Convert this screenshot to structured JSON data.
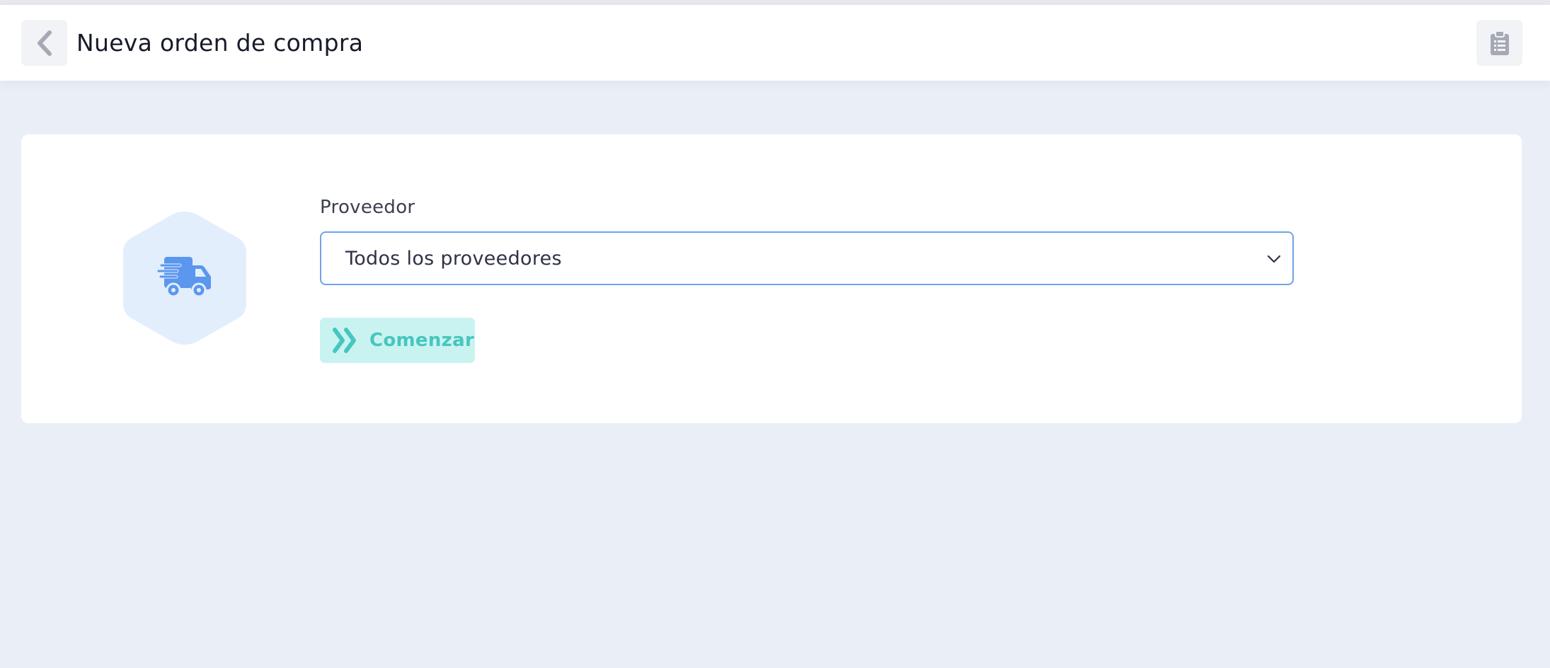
{
  "header": {
    "title": "Nueva orden de compra",
    "back_icon": "chevron-left-icon",
    "action_icon": "clipboard-list-icon"
  },
  "form": {
    "provider_label": "Proveedor",
    "provider_selected": "Todos los proveedores",
    "provider_icon": "delivery-truck-icon",
    "start_button_label": "Comenzar",
    "start_button_icon": "double-chevron-right-icon"
  },
  "colors": {
    "background": "#eaeff7",
    "card": "#ffffff",
    "accent_blue": "#5b97ee",
    "hex_fill": "#e3eefd",
    "select_border": "#6ea4ec",
    "start_bg": "#c9f3f1",
    "start_text": "#46c6bf"
  }
}
